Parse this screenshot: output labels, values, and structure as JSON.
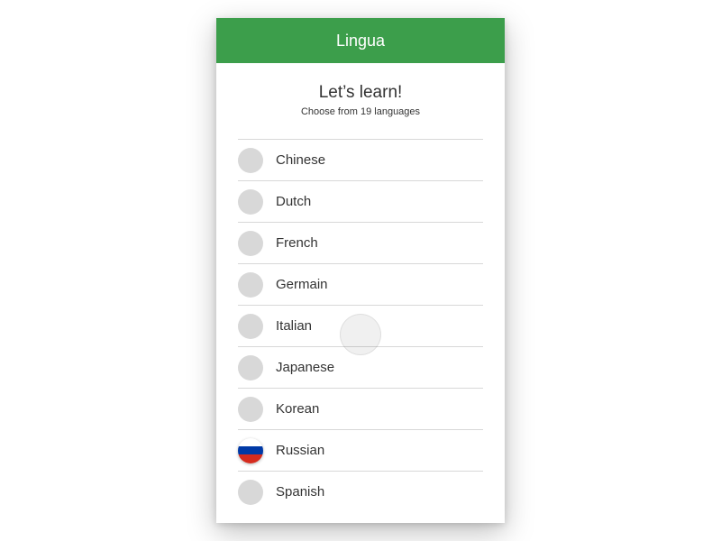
{
  "header": {
    "title": "Lingua"
  },
  "intro": {
    "heading": "Let’s learn!",
    "subheading": "Choose from 19 languages"
  },
  "languages": [
    {
      "label": "Chinese",
      "flag": "placeholder"
    },
    {
      "label": "Dutch",
      "flag": "placeholder"
    },
    {
      "label": "French",
      "flag": "placeholder"
    },
    {
      "label": "Germain",
      "flag": "placeholder"
    },
    {
      "label": "Italian",
      "flag": "placeholder"
    },
    {
      "label": "Japanese",
      "flag": "placeholder"
    },
    {
      "label": "Korean",
      "flag": "placeholder"
    },
    {
      "label": "Russian",
      "flag": "russia"
    },
    {
      "label": "Spanish",
      "flag": "placeholder"
    }
  ]
}
